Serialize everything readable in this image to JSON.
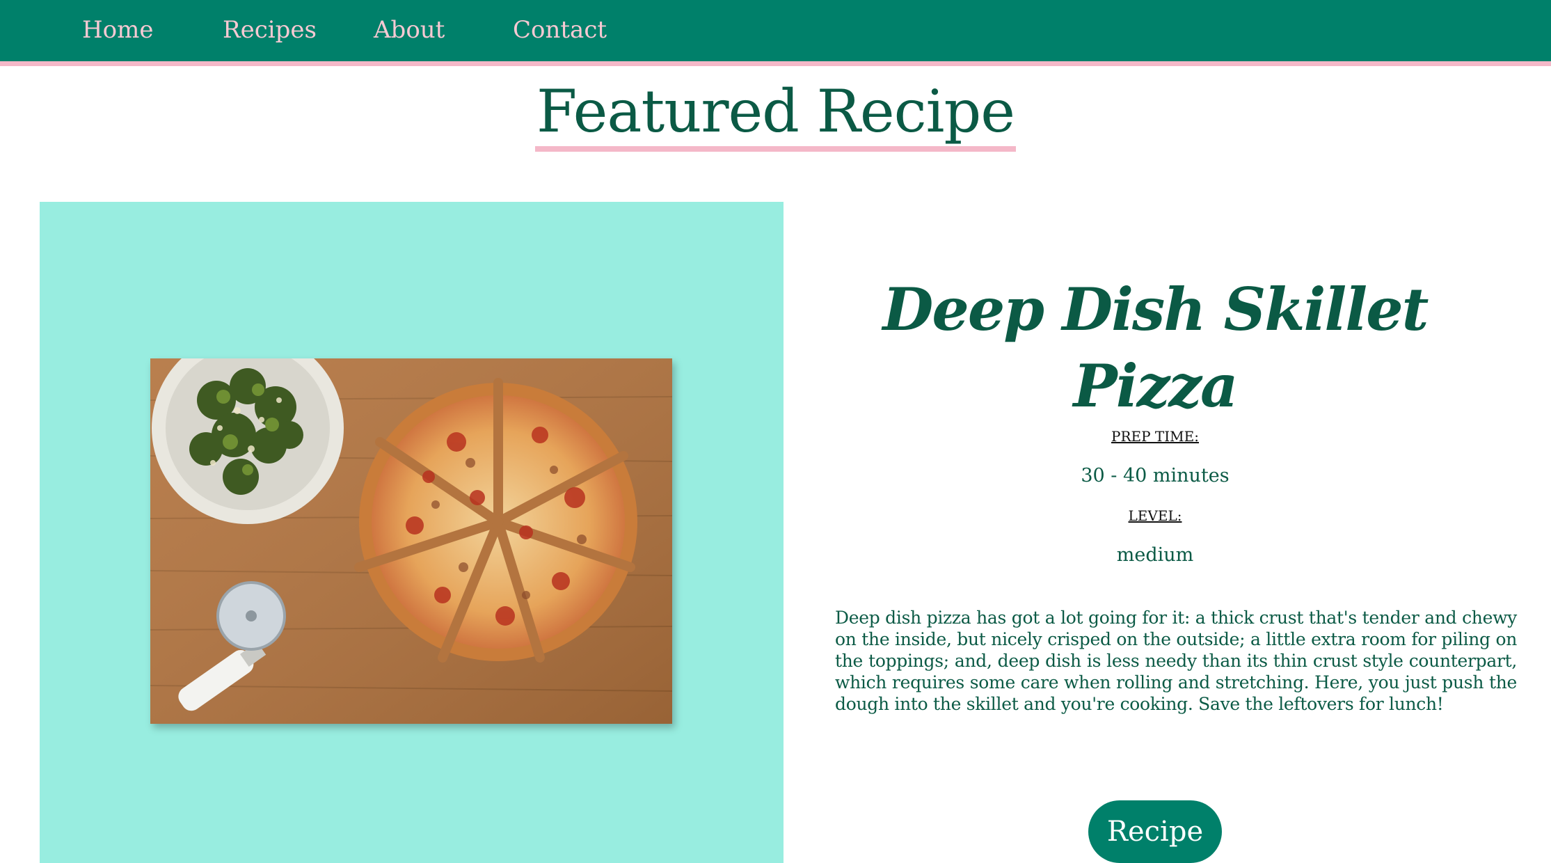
{
  "nav": {
    "items": [
      {
        "label": "Home"
      },
      {
        "label": "Recipes"
      },
      {
        "label": "About"
      },
      {
        "label": "Contact"
      }
    ]
  },
  "featured": {
    "heading": "Featured Recipe"
  },
  "recipe": {
    "title": "Deep Dish Skillet Pizza",
    "prep_label": "PREP TIME:",
    "prep_value": "30 - 40 minutes",
    "level_label": "LEVEL:",
    "level_value": "medium",
    "description": "Deep dish pizza has got a lot going for it: a thick crust that's tender and chewy on the inside, but nicely crisped on the outside; a little extra room for piling on the toppings; and, deep dish is less needy than its thin crust style counterpart, which requires some care when rolling and stretching. Here, you just push the dough into the skillet and you're cooking. Save the leftovers for lunch!",
    "button_label": "Recipe"
  },
  "colors": {
    "nav_background": "#00806a",
    "nav_accent": "#f4b8c8",
    "nav_text": "#f8c9d3",
    "heading_text": "#0b5a45",
    "image_panel": "#98ede0",
    "button_background": "#00806a"
  }
}
